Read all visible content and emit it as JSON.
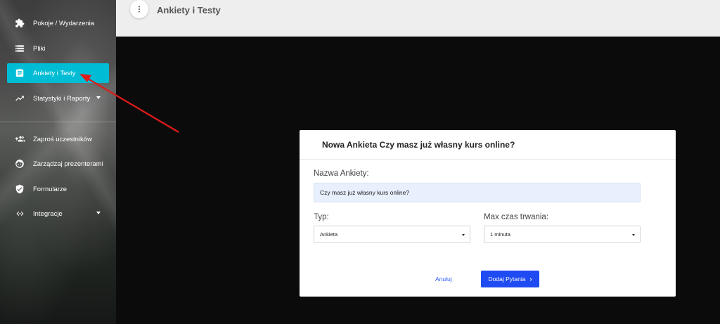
{
  "sidebar": {
    "items": [
      {
        "label": "Pokoje / Wydarzenia",
        "icon": "puzzle-icon"
      },
      {
        "label": "Pliki",
        "icon": "storage-icon"
      },
      {
        "label": "Ankiety i Testy",
        "icon": "clipboard-icon",
        "active": true
      },
      {
        "label": "Statystyki i Raporty",
        "icon": "trending-up-icon",
        "has_caret": true
      },
      {
        "label": "Zaproś uczestników",
        "icon": "group-add-icon"
      },
      {
        "label": "Zarządzaj prezenterami",
        "icon": "face-icon"
      },
      {
        "label": "Formularze",
        "icon": "verified-shield-icon"
      },
      {
        "label": "Integracje",
        "icon": "code-arrows-icon",
        "has_caret": true
      }
    ]
  },
  "header": {
    "title": "Ankiety i Testy"
  },
  "modal": {
    "title": "Nowa Ankieta Czy masz już własny kurs online?",
    "name_label": "Nazwa Ankiety:",
    "name_value": "Czy masz już własny kurs online?",
    "type_label": "Typ:",
    "type_value": "Ankieta",
    "duration_label": "Max czas trwania:",
    "duration_value": "1 minuta",
    "cancel_label": "Anuluj",
    "submit_label": "Dodaj Pytania"
  },
  "colors": {
    "active_item": "#00bcd4",
    "primary_button": "#1f4bf2",
    "annotation_arrow": "#e01b1b"
  }
}
